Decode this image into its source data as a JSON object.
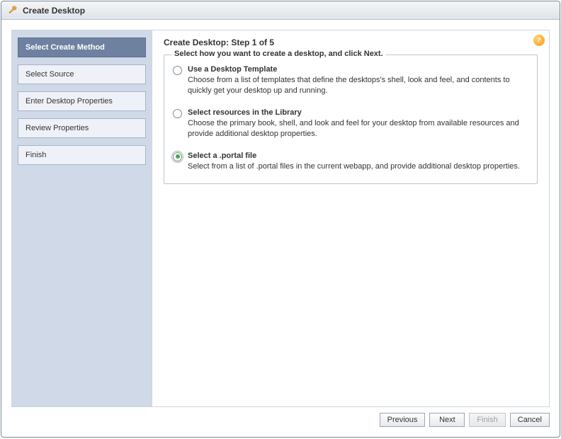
{
  "window": {
    "title": "Create Desktop"
  },
  "sidebar": {
    "steps": [
      {
        "label": "Select Create Method",
        "active": true
      },
      {
        "label": "Select Source",
        "active": false
      },
      {
        "label": "Enter Desktop Properties",
        "active": false
      },
      {
        "label": "Review Properties",
        "active": false
      },
      {
        "label": "Finish",
        "active": false
      }
    ]
  },
  "content": {
    "heading": "Create Desktop: Step 1 of 5",
    "legend": "Select how you want to create a desktop, and click Next.",
    "options": [
      {
        "title": "Use a Desktop Template",
        "desc": "Choose from a list of templates that define the desktops's shell, look and feel, and contents to quickly get your desktop up and running.",
        "selected": false
      },
      {
        "title": "Select resources in the Library",
        "desc": "Choose the primary book, shell, and look and feel for your desktop from available resources and provide additional desktop properties.",
        "selected": false
      },
      {
        "title": "Select a .portal file",
        "desc": "Select from a list of .portal files in the current webapp, and provide additional desktop properties.",
        "selected": true
      }
    ]
  },
  "help": {
    "glyph": "?"
  },
  "footer": {
    "previous": "Previous",
    "next": "Next",
    "finish": "Finish",
    "cancel": "Cancel"
  }
}
